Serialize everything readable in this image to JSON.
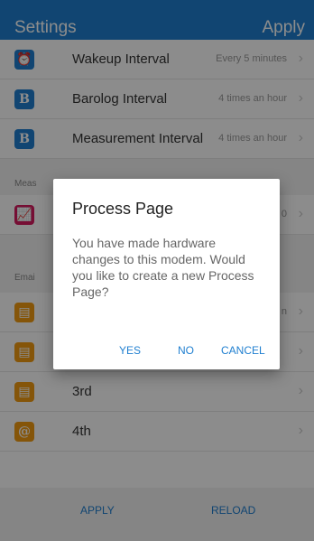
{
  "header": {
    "title": "Settings",
    "apply": "Apply"
  },
  "rows": [
    {
      "label": "Wakeup Interval",
      "value": "Every 5 minutes",
      "icon": "alarm-icon",
      "icon_char": "⏰"
    },
    {
      "label": "Barolog Interval",
      "value": "4 times an hour",
      "icon": "b-icon",
      "icon_char": "B"
    },
    {
      "label": "Measurement Interval",
      "value": "4 times an hour",
      "icon": "b-icon",
      "icon_char": "B"
    },
    {
      "label": "",
      "value": "0",
      "icon": "chart-icon",
      "icon_char": "📈"
    },
    {
      "label": "",
      "value": "n",
      "icon": "id-card-icon",
      "icon_char": "🪪"
    },
    {
      "label": "",
      "value": "",
      "icon": "id-card-icon",
      "icon_char": "🪪"
    },
    {
      "label": "3rd",
      "value": "",
      "icon": "id-card-icon",
      "icon_char": "🪪"
    },
    {
      "label": "4th",
      "value": "",
      "icon": "at-icon",
      "icon_char": "@"
    }
  ],
  "sections": {
    "meas": "Meas",
    "email": "Emai"
  },
  "dialog": {
    "title": "Process Page",
    "message": "You have made hardware changes to this modem. Would you like to create a new Process Page?",
    "yes": "YES",
    "no": "NO",
    "cancel": "CANCEL"
  },
  "bottom": {
    "apply": "APPLY",
    "reload": "RELOAD"
  },
  "colors": {
    "accent": "#1f7fd0",
    "danger": "#d81b60",
    "warning": "#f39c12"
  }
}
